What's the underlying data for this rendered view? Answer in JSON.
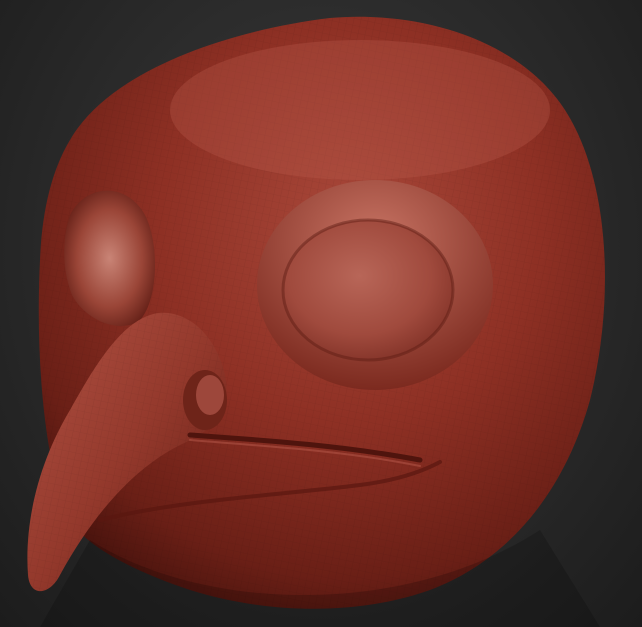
{
  "scene": {
    "background_color": "#2c2c2c",
    "model": {
      "subject": "sculpted-bird-head",
      "base_color": "#8c2f22",
      "highlight_color": "#c86a5c",
      "shadow_color": "#4a120c"
    }
  }
}
